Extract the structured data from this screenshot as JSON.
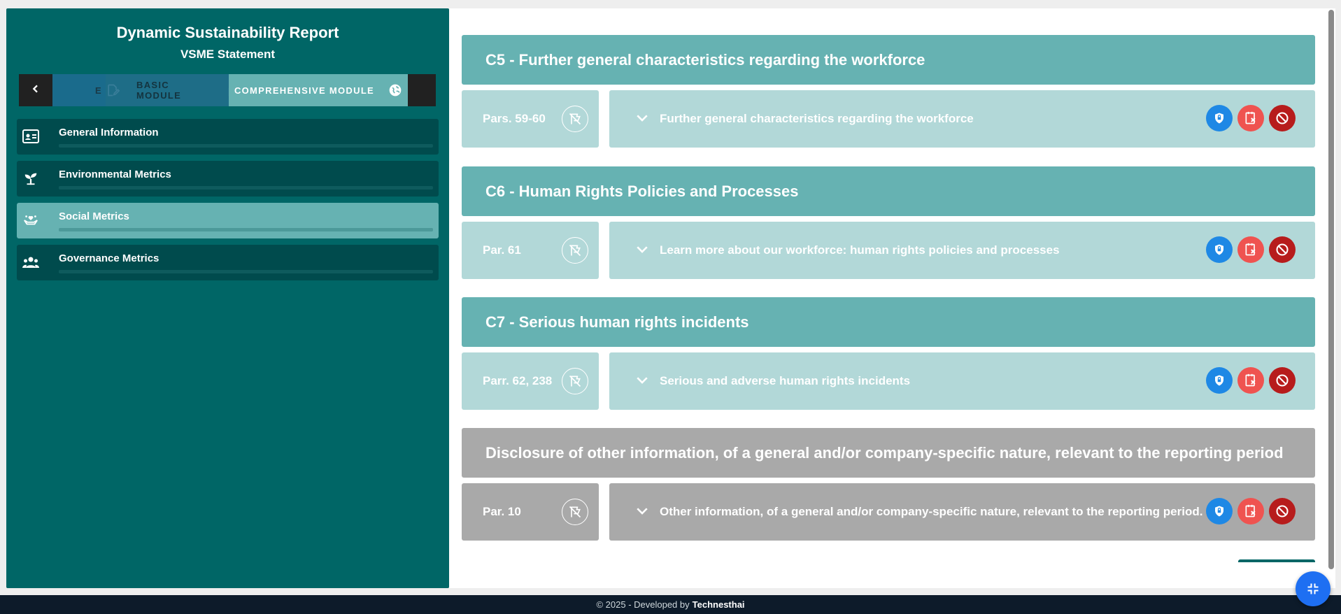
{
  "sidebar": {
    "title": "Dynamic Sustainability Report",
    "subtitle": "VSME Statement",
    "modules": {
      "prev_label": "E",
      "basic_label": "BASIC MODULE",
      "comprehensive_label": "COMPREHENSIVE MODULE"
    },
    "items": [
      {
        "label": "General Information",
        "icon": "id-card-icon"
      },
      {
        "label": "Environmental Metrics",
        "icon": "sprout-icon"
      },
      {
        "label": "Social Metrics",
        "icon": "hands-heart-icon",
        "active": true
      },
      {
        "label": "Governance Metrics",
        "icon": "people-group-icon"
      }
    ]
  },
  "sections": [
    {
      "header": "C5 - Further general characteristics regarding the workforce",
      "par": "Pars. 59-60",
      "title": "Further general characteristics regarding the workforce"
    },
    {
      "header": "C6 - Human Rights Policies and Processes",
      "par": "Par. 61",
      "title": "Learn more about our workforce: human rights policies and processes"
    },
    {
      "header": "C7 - Serious human rights incidents",
      "par": "Parr. 62, 238",
      "title": "Serious and adverse human rights incidents"
    },
    {
      "header": "Disclosure of other information, of a general and/or company-specific nature, relevant to the reporting period",
      "par": "Par. 10",
      "title": "Other information, of a general and/or company-specific nature, relevant to the reporting period."
    }
  ],
  "footer": {
    "text": "© 2025 - Developed by",
    "brand": "Technesthai"
  },
  "colors": {
    "sidebar_bg": "#006666",
    "teal_header": "#66b2b2",
    "teal_light": "#b2d8d8",
    "grey": "#a9a9a9",
    "shield_blue": "#1e88e5",
    "remove_red": "#ef5350",
    "block_darkred": "#b71c1c"
  }
}
